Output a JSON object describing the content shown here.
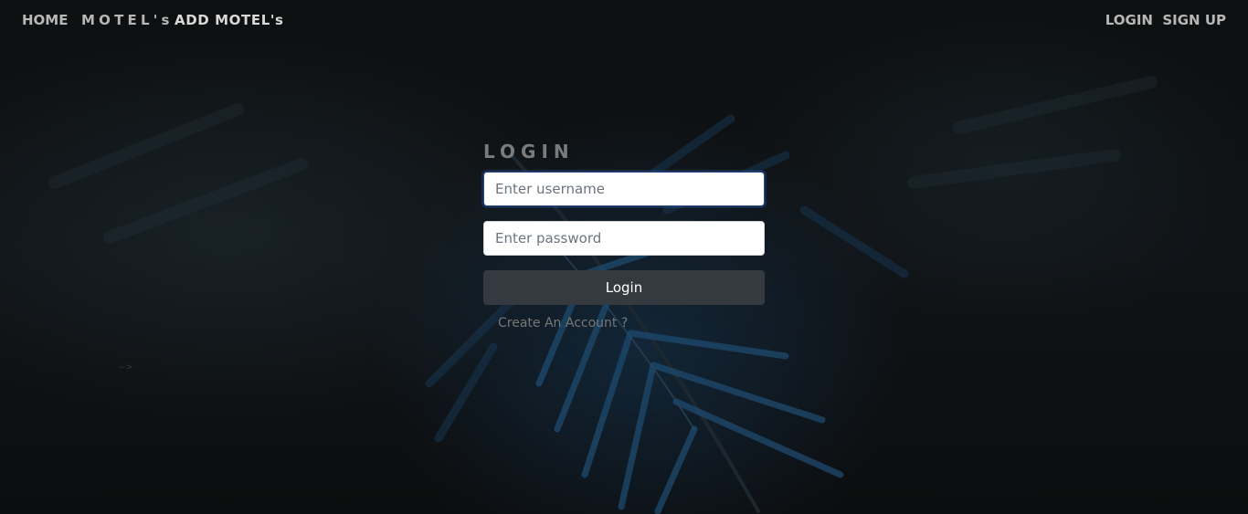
{
  "nav": {
    "home": "HOME",
    "motels": "MOTEL's",
    "add_motels": "ADD MOTEL's",
    "login": "LOGIN",
    "signup": "SIGN UP"
  },
  "login_form": {
    "title": "LOGIN",
    "username_placeholder": "Enter username",
    "password_placeholder": "Enter password",
    "submit_label": "Login",
    "create_account_link": "Create An Account ?"
  },
  "stray_text": "-->",
  "colors": {
    "background": "#111111",
    "button": "#343a40",
    "nav_text": "#b7b7b7",
    "accent_focus": "#2a4a8a"
  }
}
